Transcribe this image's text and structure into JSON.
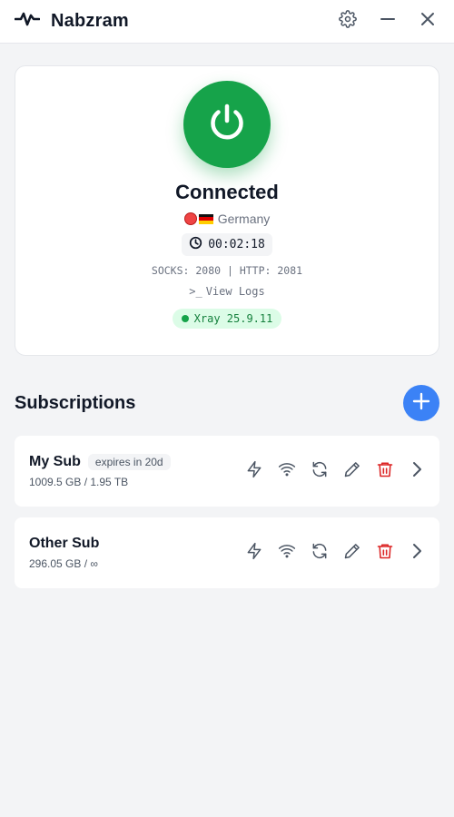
{
  "app": {
    "title": "Nabzram"
  },
  "status": {
    "state": "Connected",
    "location": "Germany",
    "uptime": "00:02:18",
    "ports": "SOCKS: 2080 | HTTP: 2081",
    "view_logs": "View Logs",
    "view_logs_prompt": ">_",
    "core_version": "Xray 25.9.11"
  },
  "subscriptions": {
    "title": "Subscriptions",
    "items": [
      {
        "name": "My Sub",
        "expiry": "expires in 20d",
        "usage": "1009.5 GB / 1.95 TB"
      },
      {
        "name": "Other Sub",
        "expiry": "",
        "usage": "296.05 GB / ∞"
      }
    ]
  },
  "colors": {
    "connected": "#16a34a",
    "accent": "#3b82f6",
    "danger": "#dc2626",
    "background": "#f3f4f6"
  },
  "icons": {
    "logo": "pulse-icon",
    "settings": "gear-icon",
    "minimize": "minimize-icon",
    "close": "close-icon",
    "power": "power-icon",
    "clock": "clock-icon",
    "terminal": "terminal-icon",
    "add": "plus-icon",
    "test": "lightning-icon",
    "ping": "wifi-icon",
    "refresh": "refresh-icon",
    "edit": "pencil-icon",
    "delete": "trash-icon",
    "open": "chevron-right-icon"
  }
}
